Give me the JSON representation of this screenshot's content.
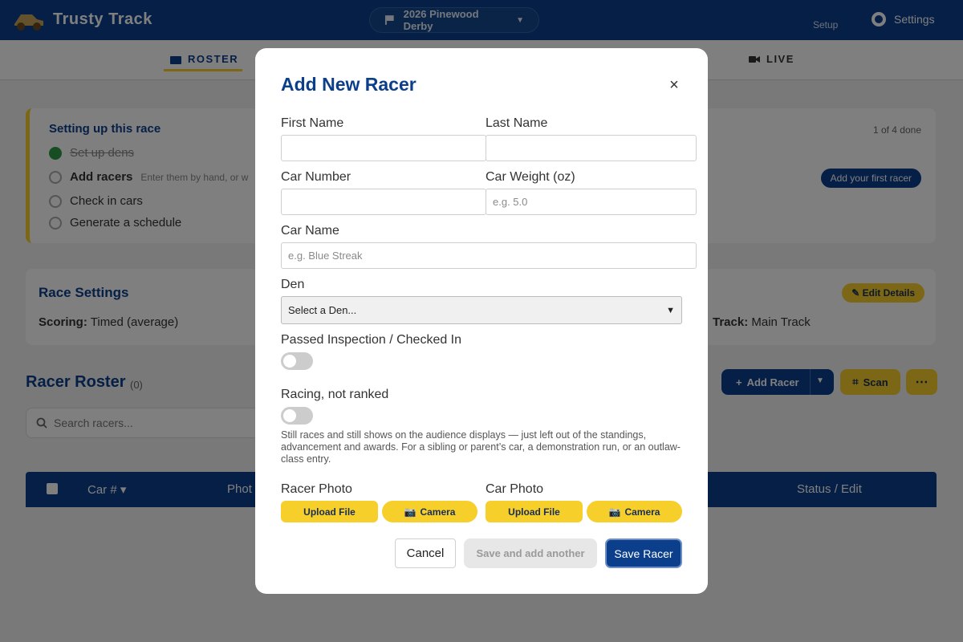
{
  "app": {
    "title": "Trusty Track",
    "race_selector": "2026 Pinewood Derby",
    "setup_link": "Setup",
    "settings_label": "Settings"
  },
  "tabs": [
    {
      "label": "ROSTER",
      "icon": "roster-icon",
      "active": true
    },
    {
      "label": "LIVE",
      "icon": "camera-icon",
      "active": false
    }
  ],
  "checklist": {
    "title": "Setting up this race",
    "progress": "1 of 4 done",
    "steps": [
      {
        "label": "Set up dens",
        "done": true
      },
      {
        "label": "Add racers",
        "hint": "Enter them by hand, or w",
        "done": false
      },
      {
        "label": "Check in cars",
        "done": false
      },
      {
        "label": "Generate a schedule",
        "done": false
      }
    ],
    "action_label": "Add your first racer"
  },
  "race_settings": {
    "title": "Race Settings",
    "scoring_label": "Scoring:",
    "scoring_value": "Timed (average)",
    "track_label": "Track:",
    "track_value": "Main Track",
    "edit_label": "Edit Details"
  },
  "roster": {
    "title": "Racer Roster",
    "count": "(0)",
    "search_placeholder": "Search racers...",
    "add_label": "Add Racer",
    "scan_label": "Scan",
    "more_label": "⋯",
    "columns": {
      "car": "Car #",
      "car_sort": "▾",
      "photo": "Phot",
      "status": "Status / Edit"
    }
  },
  "modal": {
    "title": "Add New Racer",
    "close_glyph": "×",
    "fields": {
      "first_name": {
        "label": "First Name",
        "value": "",
        "placeholder": ""
      },
      "last_name": {
        "label": "Last Name",
        "value": "",
        "placeholder": ""
      },
      "car_number": {
        "label": "Car Number",
        "value": "",
        "placeholder": ""
      },
      "car_weight": {
        "label": "Car Weight (oz)",
        "value": "",
        "placeholder": "e.g. 5.0"
      },
      "car_name": {
        "label": "Car Name",
        "value": "",
        "placeholder": "e.g. Blue Streak"
      },
      "den": {
        "label": "Den",
        "selected": "Select a Den..."
      }
    },
    "passed_inspection": {
      "label": "Passed Inspection / Checked In",
      "on": false
    },
    "racing_not_ranked": {
      "label": "Racing, not ranked",
      "on": false,
      "help": "Still races and still shows on the audience displays — just left out of the standings, advancement and awards. For a sibling or parent’s car, a demonstration run, or an outlaw-class entry."
    },
    "racer_photo": {
      "label": "Racer Photo",
      "upload_label": "Upload File",
      "camera_label": "Camera"
    },
    "car_photo": {
      "label": "Car Photo",
      "upload_label": "Upload File",
      "camera_label": "Camera"
    },
    "buttons": {
      "cancel": "Cancel",
      "save_another": "Save and add another",
      "save": "Save Racer"
    }
  },
  "colors": {
    "brand_blue": "#0b3f8c",
    "accent_yellow": "#f6cf2a",
    "success_green": "#2e9b44"
  }
}
